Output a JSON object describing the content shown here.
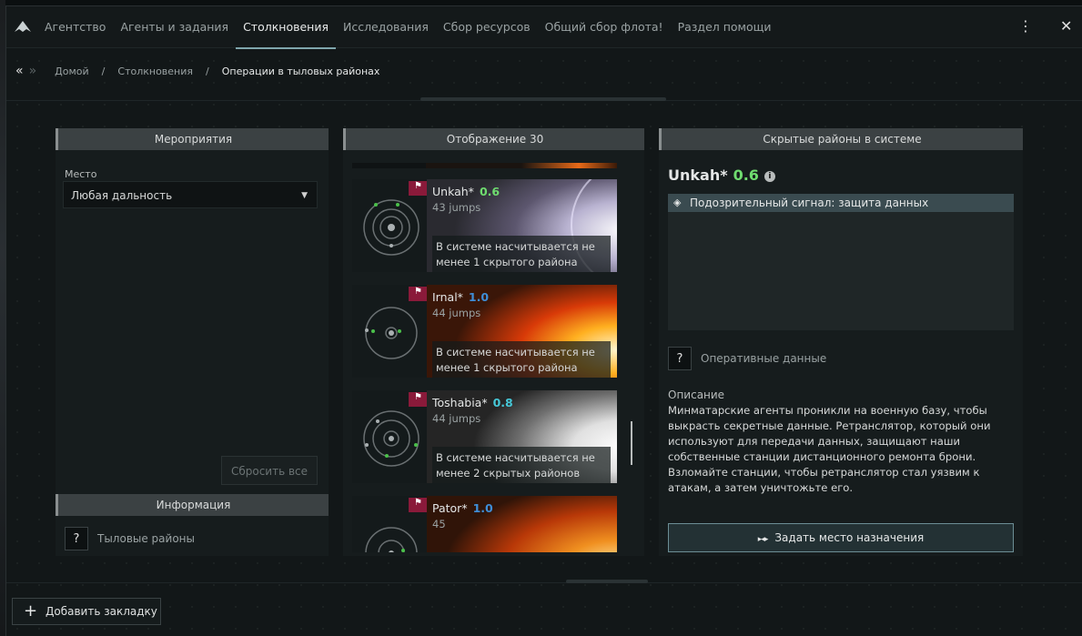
{
  "window": {
    "tabs": [
      {
        "label": "Агентство",
        "active": false
      },
      {
        "label": "Агенты и задания",
        "active": false
      },
      {
        "label": "Столкновения",
        "active": true
      },
      {
        "label": "Исследования",
        "active": false
      },
      {
        "label": "Сбор ресурсов",
        "active": false
      },
      {
        "label": "Общий сбор флота!",
        "active": false
      },
      {
        "label": "Раздел помощи",
        "active": false
      }
    ],
    "menu_icon": "more-vertical-icon",
    "close_icon": "close-icon"
  },
  "breadcrumb": {
    "items": [
      "Домой",
      "Столкновения",
      "Операции в тыловых районах"
    ],
    "separator": "/"
  },
  "events_panel": {
    "title": "Мероприятия",
    "location_label": "Место",
    "location_value": "Любая дальность",
    "reset_label": "Сбросить все",
    "info_title": "Информация",
    "info_help": "?",
    "info_label": "Тыловые районы"
  },
  "list_panel": {
    "title": "Отображение 30",
    "systems": [
      {
        "name": "Unkah*",
        "security": "0.6",
        "security_color": "#6fdc6f",
        "jumps": "43 jumps",
        "note": "В системе насчитывается не менее 1 скрытого района"
      },
      {
        "name": "Irnal*",
        "security": "1.0",
        "security_color": "#3f8ed8",
        "jumps": "44 jumps",
        "note": "В системе насчитывается не менее 1 скрытого района"
      },
      {
        "name": "Toshabia*",
        "security": "0.8",
        "security_color": "#46c8d8",
        "jumps": "44 jumps",
        "note": "В системе насчитывается не менее 2 скрытых районов"
      },
      {
        "name": "Pator*",
        "security": "1.0",
        "security_color": "#3f8ed8",
        "jumps": "45",
        "note": ""
      }
    ]
  },
  "details_panel": {
    "title": "Скрытые районы в системе",
    "system_name": "Unkah*",
    "system_security": "0.6",
    "sites": [
      "Подозрительный сигнал: защита данных"
    ],
    "op_help": "?",
    "op_label": "Оперативные данные",
    "description_title": "Описание",
    "description": "Минматарские агенты проникли на военную базу, чтобы выкрасть секретные данные. Ретранслятор, который они используют для передачи данных, защищают наши собственные станции дистанционного ремонта брони. Взломайте станции, чтобы ретранслятор стал уязвим к атакам, а затем уничтожьте его.",
    "destination_label": "Задать место назначения"
  },
  "footer": {
    "bookmark_label": "Добавить закладку"
  },
  "colors": {
    "accent": "#7fa6ad",
    "panel_header": "#3b4143",
    "security_green": "#6fdc6f",
    "security_blue": "#3f8ed8",
    "security_cyan": "#46c8d8"
  }
}
